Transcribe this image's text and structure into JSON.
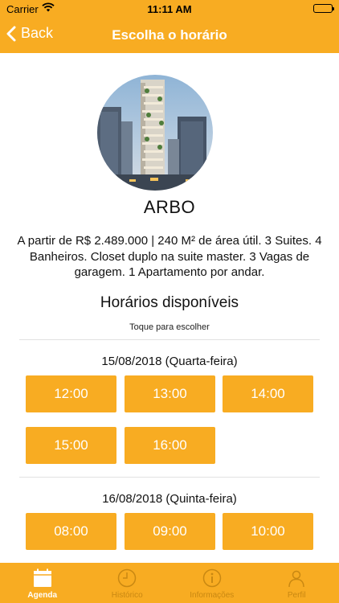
{
  "status_bar": {
    "carrier": "Carrier",
    "time": "11:11 AM"
  },
  "nav": {
    "back_label": "Back",
    "title": "Escolha o horário"
  },
  "property": {
    "name": "ARBO",
    "description": "A partir de R$ 2.489.000 | 240 M² de área útil. 3 Suites. 4 Banheiros. Closet duplo na suite master. 3 Vagas de garagem. 1 Apartamento por andar."
  },
  "schedule": {
    "title": "Horários disponíveis",
    "hint": "Toque para escolher",
    "days": [
      {
        "date": "15/08/2018 (Quarta-feira)",
        "times": [
          "12:00",
          "13:00",
          "14:00",
          "15:00",
          "16:00"
        ]
      },
      {
        "date": "16/08/2018 (Quinta-feira)",
        "times": [
          "08:00",
          "09:00",
          "10:00"
        ]
      }
    ]
  },
  "tabs": [
    {
      "label": "Agenda",
      "icon": "calendar-icon",
      "active": true
    },
    {
      "label": "Histórico",
      "icon": "clock-icon",
      "active": false
    },
    {
      "label": "Informações",
      "icon": "info-icon",
      "active": false
    },
    {
      "label": "Perfil",
      "icon": "person-icon",
      "active": false
    }
  ],
  "colors": {
    "accent": "#F8AC22",
    "tab_inactive": "#C98812"
  }
}
